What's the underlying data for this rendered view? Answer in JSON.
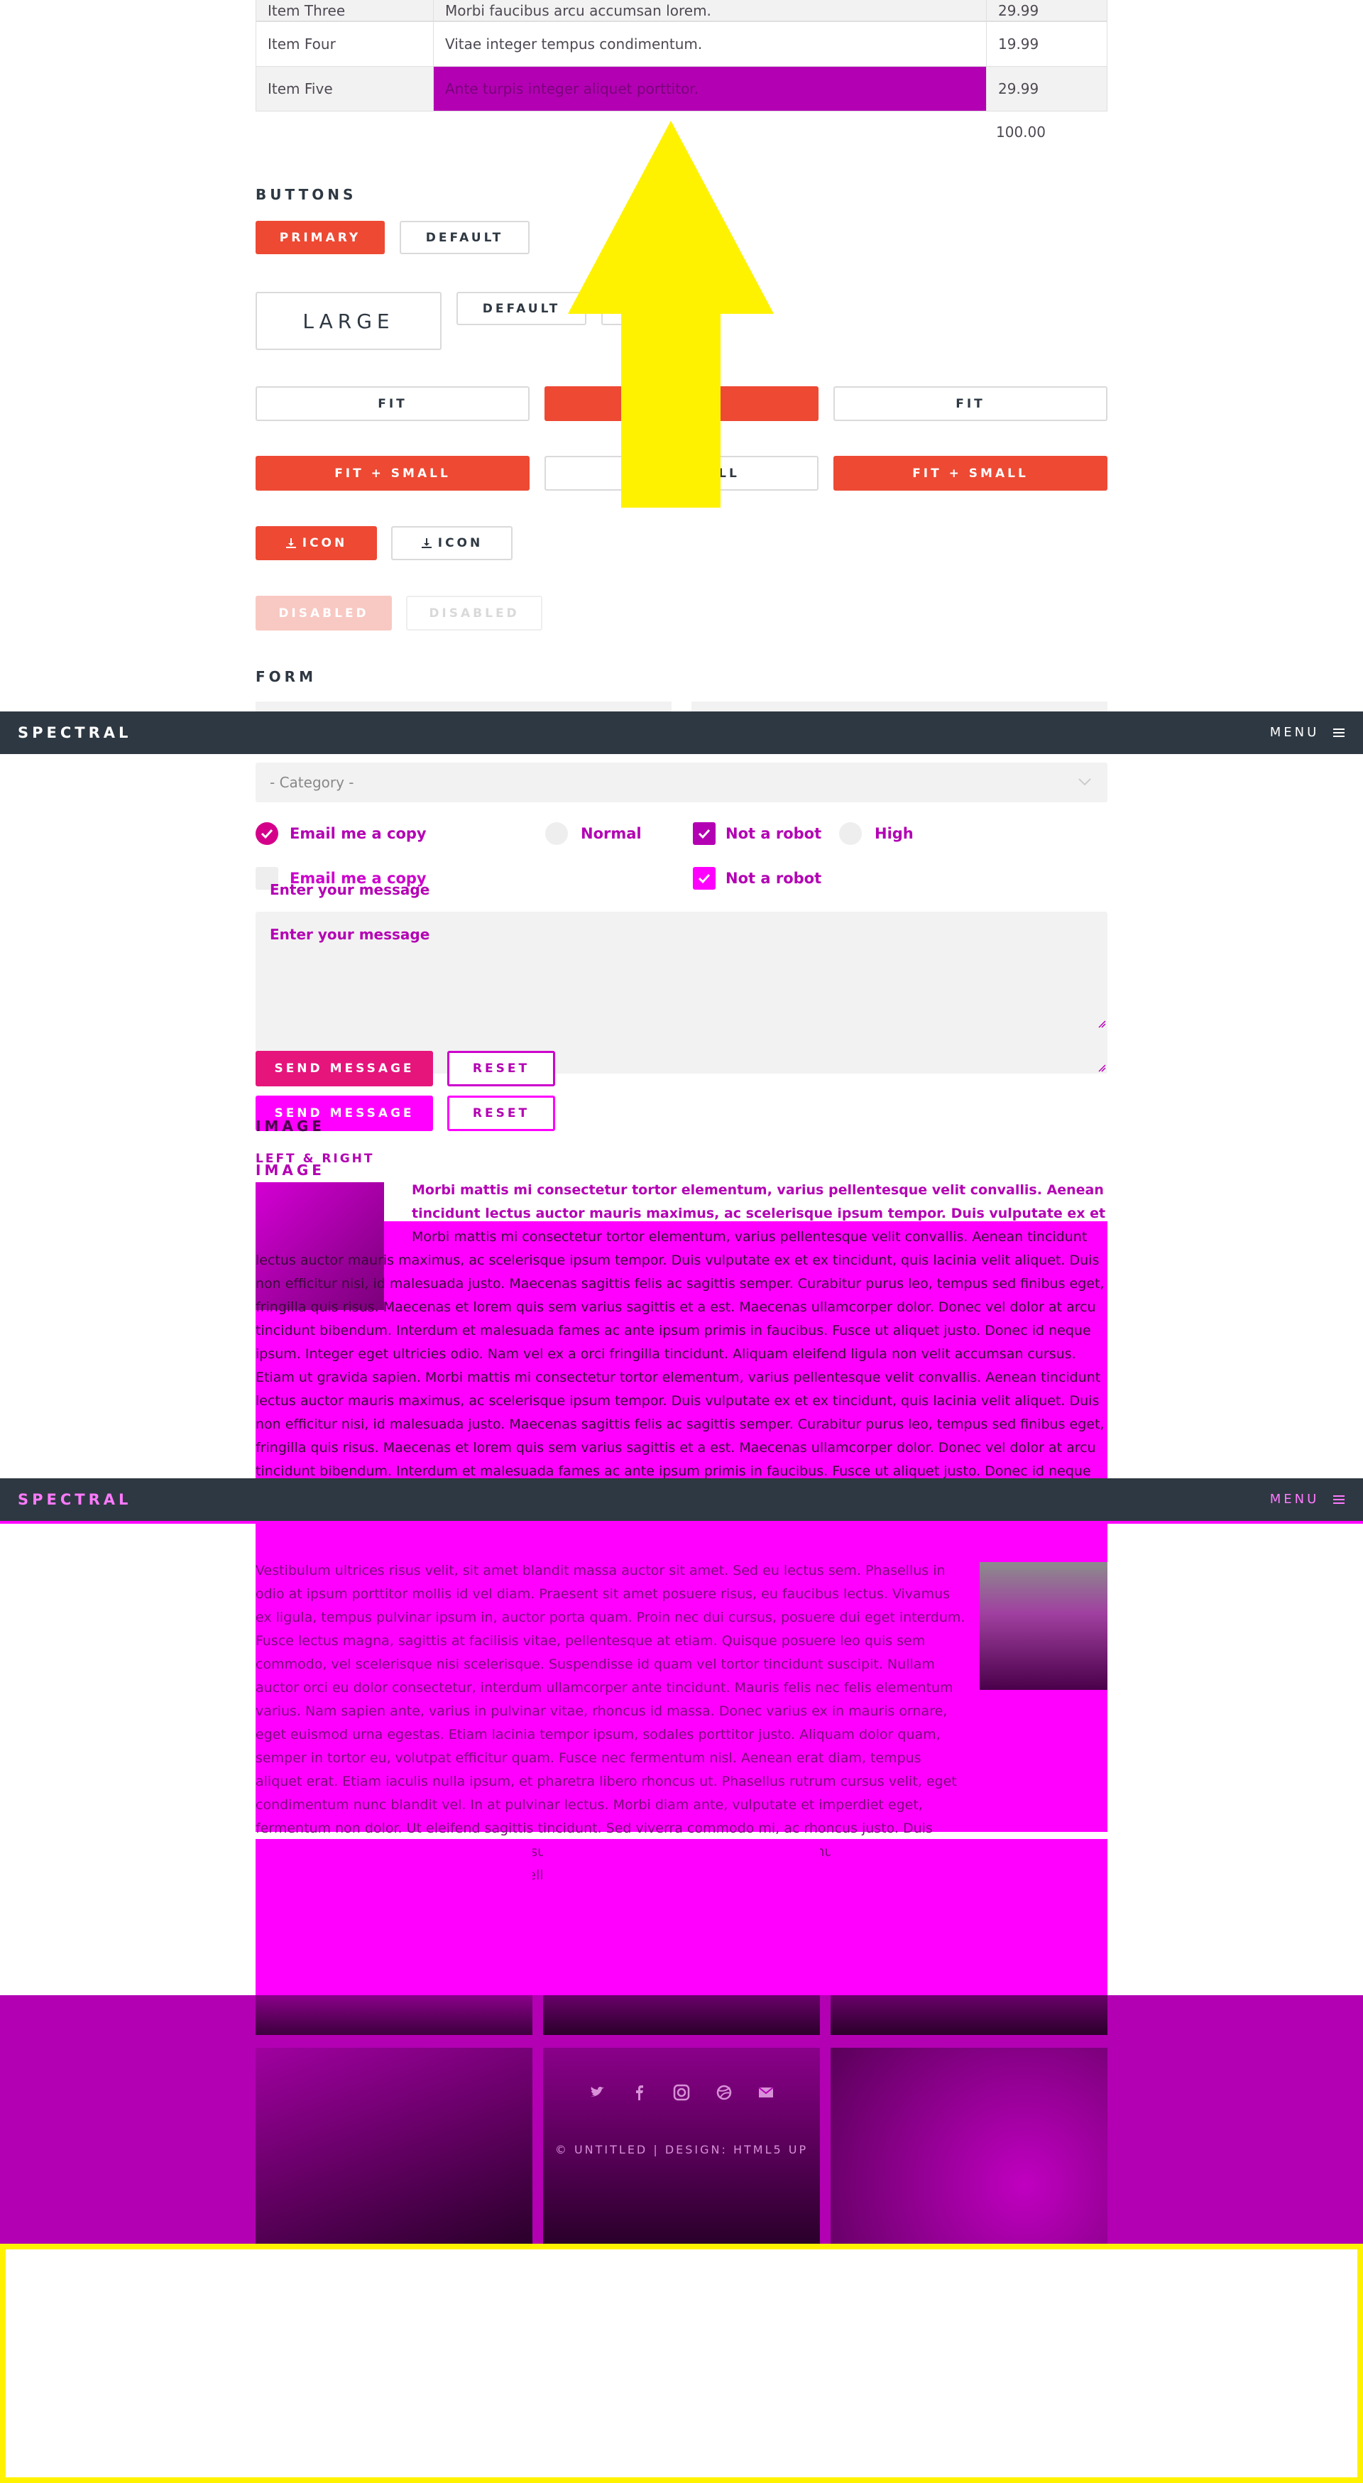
{
  "table": {
    "rows": [
      {
        "name": "Item Three",
        "desc": "Morbi faucibus arcu accumsan lorem.",
        "price": "29.99"
      },
      {
        "name": "Item Four",
        "desc": "Vitae integer tempus condimentum.",
        "price": "19.99"
      },
      {
        "name": "Item Five",
        "desc": "Ante turpis integer aliquet porttitor.",
        "price": "29.99"
      }
    ],
    "total": "100.00"
  },
  "buttons": {
    "heading": "Buttons",
    "primary": "Primary",
    "default": "Default",
    "large": "Large",
    "default_small": "Default",
    "fit": "Fit",
    "fit_small": "Fit + Small",
    "icon": "Icon",
    "disabled": "Disabled"
  },
  "form": {
    "heading": "Form",
    "category": "- Category -",
    "email_copy": "Email me a copy",
    "normal": "Normal",
    "not_robot": "Not a robot",
    "high": "High",
    "message_placeholder": "Enter your message",
    "send": "Send Message",
    "reset": "Reset"
  },
  "navbar": {
    "brand": "SPECTRAL",
    "menu": "MENU"
  },
  "image": {
    "heading": "Image",
    "subheading": "Left & Right",
    "para1": "Morbi mattis mi consectetur tortor elementum, varius pellentesque velit convallis. Aenean tincidunt lectus auctor mauris maximus, ac scelerisque ipsum tempor. Duis vulputate ex et ex tincidunt, quis lacinia velit aliquet. Duis non efficitur nisi, id malesuada justo. Maecenas sagittis felis ac sagittis semper. Curabitur purus leo, tempus sed finibus eget, fringilla quis risus. Maecenas et lorem quis sem varius sagittis et a est. Maecenas ullamcorper dolor. Donec vel dolor at arcu tincidunt bibendum. Interdum et malesuada fames ac ante ipsum primis in faucibus. Fusce ut aliquet justo. Donec id neque ipsum. Integer eget ultricies odio. Nam vel ex a orci fringilla tincidunt. Aliquam eleifend ligula non velit accumsan cursus. Etiam ut gravida sapien. Morbi mattis mi consectetur tortor elementum, varius pellentesque velit convallis. Aenean tincidunt lectus auctor mauris maximus, ac scelerisque ipsum tempor. Duis vulputate ex et ex tincidunt, quis lacinia velit aliquet. Duis non efficitur nisi, id malesuada justo. Maecenas sagittis felis ac sagittis semper. Curabitur purus leo, tempus sed finibus eget, fringilla quis risus. Maecenas et lorem quis sem varius sagittis et a est. Maecenas ullamcorper dolor. Donec vel dolor at arcu tincidunt bibendum. Interdum et malesuada fames ac ante ipsum primis in faucibus. Fusce ut aliquet justo. Donec id neque ipsum. Integer eget ultricies odio. Nam vel ex a orci fringilla tincidunt. Aliquam eleifend ligula non velit accumsan cursus. Etiam ut gravida sapien.",
    "para2": "Vestibulum ultrices risus velit, sit amet blandit massa auctor sit amet. Sed eu lectus sem. Phasellus in odio at ipsum porttitor mollis id vel diam. Praesent sit amet posuere risus, eu faucibus lectus. Vivamus ex ligula, tempus pulvinar ipsum in, auctor porta quam. Proin nec dui cursus, posuere dui eget interdum. Fusce lectus magna, sagittis at facilisis vitae, pellentesque at etiam. Quisque posuere leo quis sem commodo, vel scelerisque nisi scelerisque. Suspendisse id quam vel tortor tincidunt suscipit. Nullam auctor orci eu dolor consectetur, interdum ullamcorper ante tincidunt. Mauris felis nec felis elementum varius. Nam sapien ante, varius in pulvinar vitae, rhoncus id massa. Donec varius ex in mauris ornare, eget euismod urna egestas. Etiam lacinia tempor ipsum, sodales porttitor justo. Aliquam dolor quam, semper in tortor eu, volutpat efficitur quam. Fusce nec fermentum nisl. Aenean erat diam, tempus aliquet erat. Etiam iaculis nulla ipsum, et pharetra libero rhoncus ut. Phasellus rutrum cursus velit, eget condimentum nunc blandit vel. In at pulvinar lectus. Morbi diam ante, vulputate et imperdiet eget, fermentum non dolor. Ut eleifend sagittis tincidunt. Sed viverra commodo mi, ac rhoncus justo. Duis neque ligula, elementum ut enim vel, posuere finibus justo. Vivamus facilisis maximus nibh quis pulvinar. Quisque hendrerit in ipsum id tellus facilisis fermentum. Proin mauris dui."
  },
  "footer": {
    "copyright": "© UNTITLED | DESIGN: HTML5 UP"
  },
  "colors": {
    "accent": "#ed4933",
    "navbar": "#2e3842",
    "overlay_magenta": "#ff00ff",
    "overlay_purple": "#b300b3",
    "arrow": "#fff200"
  }
}
